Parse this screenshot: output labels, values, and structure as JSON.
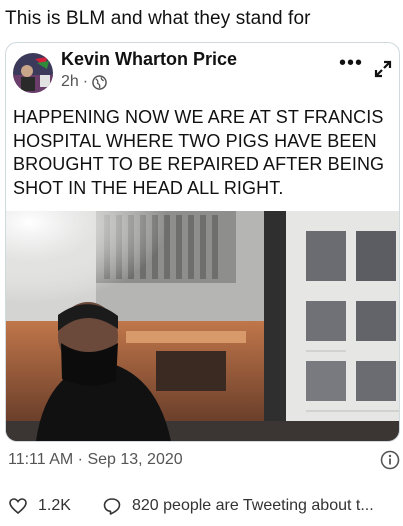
{
  "caption": "This is BLM and what they stand for",
  "tweet": {
    "author": "Kevin Wharton Price",
    "time_ago": "2h",
    "separator": "·",
    "more_label": "•••",
    "text": "HAPPENING NOW WE ARE AT ST FRANCIS HOSPITAL WHERE TWO PIGS HAVE BEEN BROUGHT TO BE REPAIRED AFTER BEING SHOT IN THE HEAD ALL RIGHT.",
    "timestamp": "11:11 AM · Sep 13, 2020"
  },
  "actions": {
    "likes": "1.2K",
    "replies": "820 people are Tweeting about t..."
  },
  "icons": {
    "avatar": "avatar",
    "globe": "globe-icon",
    "more": "more-icon",
    "expand": "expand-icon",
    "info": "info-icon",
    "heart": "heart-icon",
    "reply": "reply-icon"
  },
  "colors": {
    "border": "#cfd9de",
    "text": "#0f1419",
    "secondary": "#555555"
  }
}
